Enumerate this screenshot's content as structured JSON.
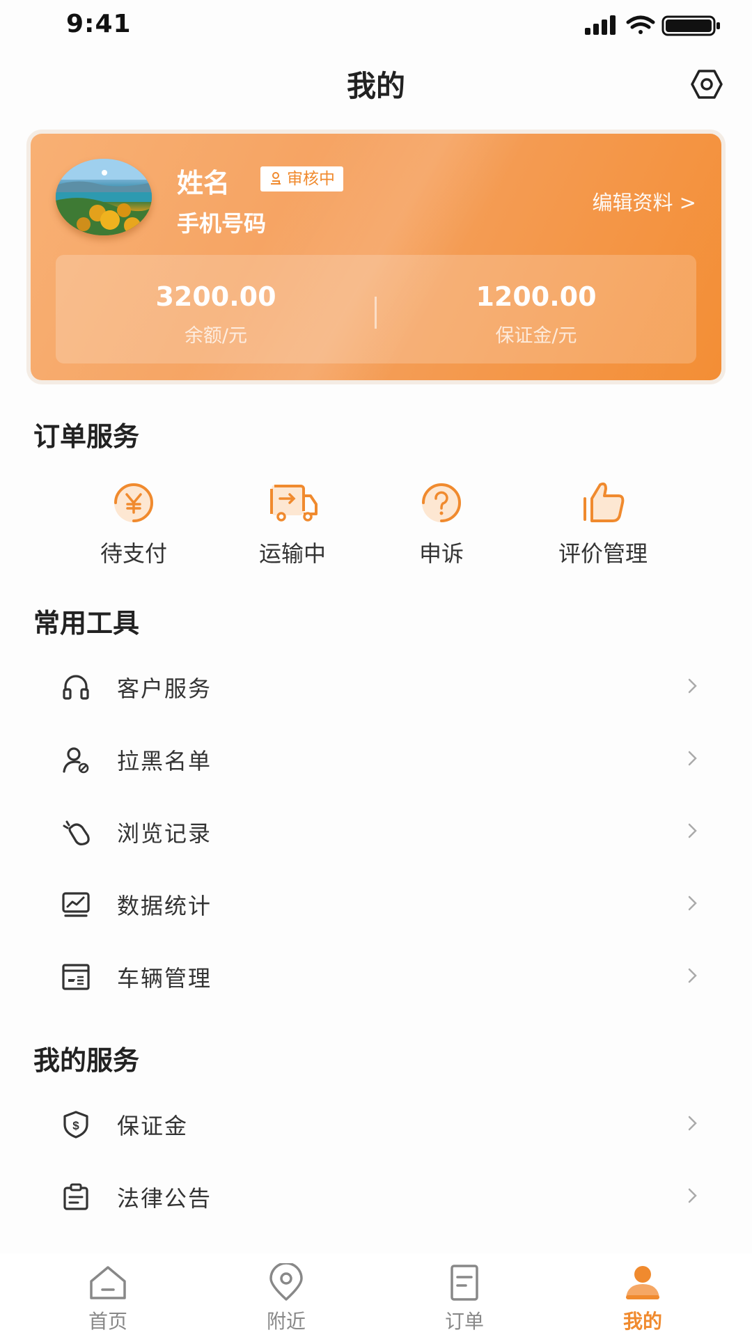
{
  "status_bar": {
    "time": "9:41"
  },
  "nav": {
    "title": "我的"
  },
  "profile": {
    "name": "姓名",
    "badge": "审核中",
    "phone": "手机号码",
    "edit_link": "编辑资料 >",
    "balance_value": "3200.00",
    "balance_label": "余额/元",
    "deposit_value": "1200.00",
    "deposit_label": "保证金/元"
  },
  "order_services": {
    "title": "订单服务",
    "items": [
      {
        "label": "待支付",
        "icon": "yen-circle-icon"
      },
      {
        "label": "运输中",
        "icon": "truck-icon"
      },
      {
        "label": "申诉",
        "icon": "question-circle-icon"
      },
      {
        "label": "评价管理",
        "icon": "thumbs-up-icon"
      }
    ]
  },
  "common_tools": {
    "title": "常用工具",
    "items": [
      {
        "label": "客户服务",
        "icon": "headset-icon"
      },
      {
        "label": "拉黑名单",
        "icon": "user-block-icon"
      },
      {
        "label": "浏览记录",
        "icon": "history-icon"
      },
      {
        "label": "数据统计",
        "icon": "chart-monitor-icon"
      },
      {
        "label": "车辆管理",
        "icon": "vehicle-card-icon"
      }
    ]
  },
  "my_services": {
    "title": "我的服务",
    "items": [
      {
        "label": "保证金",
        "icon": "shield-dollar-icon"
      },
      {
        "label": "法律公告",
        "icon": "clipboard-icon"
      }
    ]
  },
  "tabbar": {
    "items": [
      {
        "label": "首页",
        "icon": "home-icon"
      },
      {
        "label": "附近",
        "icon": "location-icon"
      },
      {
        "label": "订单",
        "icon": "document-icon"
      },
      {
        "label": "我的",
        "icon": "user-icon"
      }
    ],
    "active_index": 3
  },
  "colors": {
    "accent": "#f08a2e",
    "text": "#333333"
  }
}
